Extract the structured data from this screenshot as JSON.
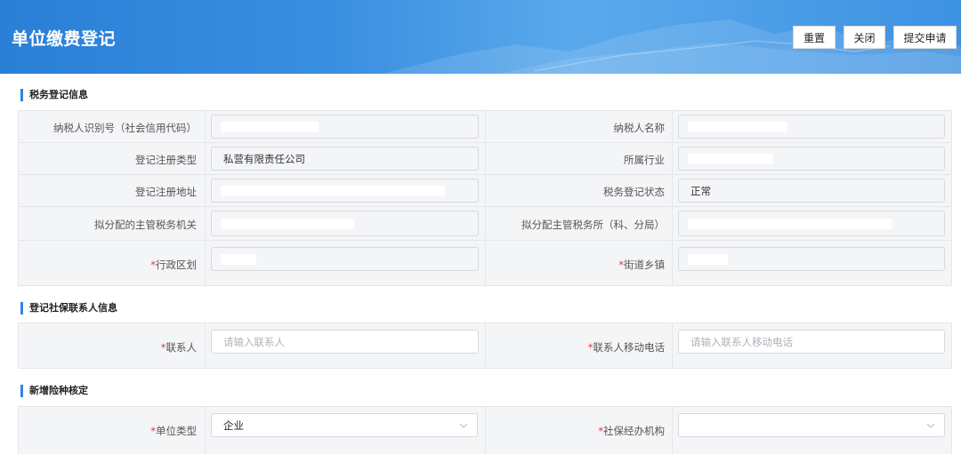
{
  "header": {
    "title": "单位缴费登记",
    "buttons": {
      "reset": "重置",
      "close": "关闭",
      "submit": "提交申请"
    }
  },
  "sections": {
    "tax": {
      "title": "税务登记信息"
    },
    "contact": {
      "title": "登记社保联系人信息"
    },
    "insurance": {
      "title": "新增险种核定"
    }
  },
  "tax_fields": {
    "taxpayer_id_label": "纳税人识别号（社会信用代码）",
    "taxpayer_name_label": "纳税人名称",
    "reg_type_label": "登记注册类型",
    "reg_type_value": "私营有限责任公司",
    "industry_label": "所属行业",
    "reg_address_label": "登记注册地址",
    "tax_status_label": "税务登记状态",
    "tax_status_value": "正常",
    "tax_authority_label": "拟分配的主管税务机关",
    "tax_office_label": "拟分配主管税务所（科、分局）",
    "district_label": "行政区划",
    "street_label": "街道乡镇",
    "required_mark": "*"
  },
  "contact_fields": {
    "contact_label": "联系人",
    "contact_placeholder": "请输入联系人",
    "mobile_label": "联系人移动电话",
    "mobile_placeholder": "请输入联系人移动电话",
    "required_mark": "*"
  },
  "insurance_fields": {
    "unit_type_label": "单位类型",
    "unit_type_value": "企业",
    "agency_label": "社保经办机构",
    "agency_value": "",
    "required_mark": "*"
  },
  "colors": {
    "header_blue": "#2a7fd6",
    "section_bar": "#2f83e3",
    "required": "#e4393c"
  }
}
